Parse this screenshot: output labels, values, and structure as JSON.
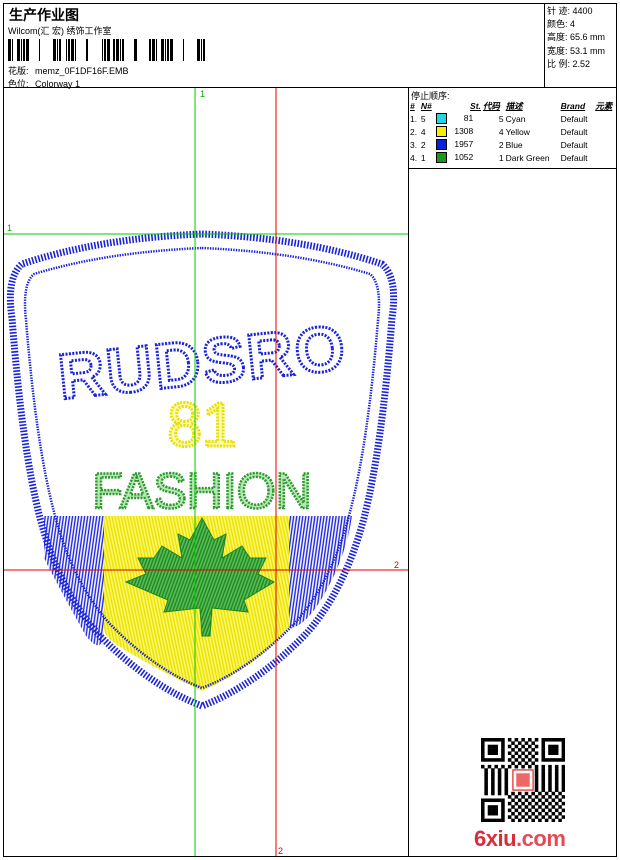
{
  "header": {
    "title": "生产作业图",
    "company": "Wilcom(汇 宏) 绣饰工作室",
    "pattern_label": "花版:",
    "pattern_value": "memz_0F1DF16F.EMB",
    "colorway_label": "色位:",
    "colorway_value": "Colorway 1"
  },
  "stats": {
    "stitches": "针 迹: 4400",
    "colors": "颜色: 4",
    "height": "高度: 65.6 mm",
    "width": "宽度: 53.1 mm",
    "ratio": "比 例: 2.52"
  },
  "sequence": {
    "title": "停止顺序:",
    "columns": [
      "#",
      "N#",
      "St.",
      "代码",
      "描述",
      "Brand",
      "元素"
    ],
    "rows": [
      {
        "idx": "1.",
        "n": "5",
        "color": "#22d8e0",
        "st": "81",
        "code": "5",
        "desc": "Cyan",
        "brand": "Default"
      },
      {
        "idx": "2.",
        "n": "4",
        "color": "#f8f000",
        "st": "1308",
        "code": "4",
        "desc": "Yellow",
        "brand": "Default"
      },
      {
        "idx": "3.",
        "n": "2",
        "color": "#0a1ee0",
        "st": "1957",
        "code": "2",
        "desc": "Blue",
        "brand": "Default"
      },
      {
        "idx": "4.",
        "n": "1",
        "color": "#1a9a1a",
        "st": "1052",
        "code": "1",
        "desc": "Dark Green",
        "brand": "Default"
      }
    ]
  },
  "design": {
    "text_top": "RUDSRO",
    "text_number": "81",
    "text_fashion": "FASHION",
    "axis_marks": {
      "green_v": "1",
      "green_h": "1",
      "red_v": "2",
      "red_h": "2"
    },
    "colors": {
      "blue": "#1a22d8",
      "yellow": "#f4f01c",
      "green": "#2a9a2a",
      "crosshair_red": "#e00000",
      "crosshair_green": "#00cc00"
    }
  },
  "watermark": {
    "logo_main": "6xiu",
    "logo_suffix": ".com"
  }
}
